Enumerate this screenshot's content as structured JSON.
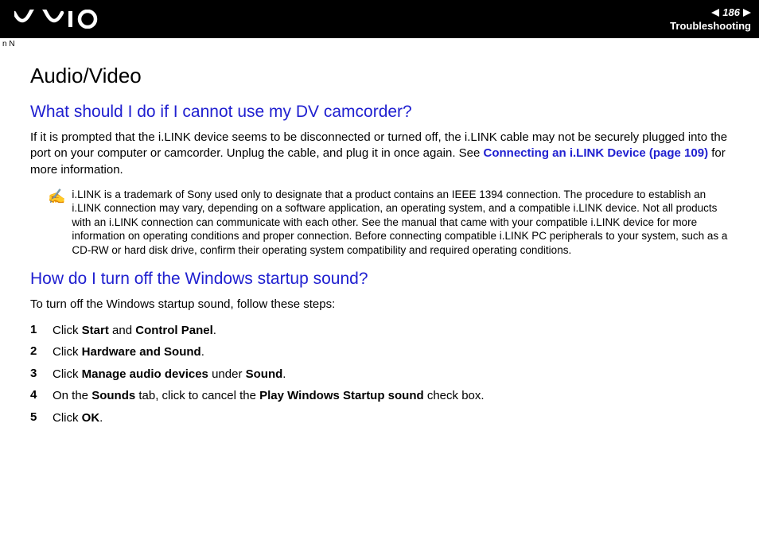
{
  "header": {
    "page_number": "186",
    "section": "Troubleshooting"
  },
  "content": {
    "title": "Audio/Video",
    "q1_heading": "What should I do if I cannot use my DV camcorder?",
    "q1_body_pre": "If it is prompted that the i.LINK device seems to be disconnected or turned off, the i.LINK cable may not be securely plugged into the port on your computer or camcorder. Unplug the cable, and plug it in once again. See ",
    "q1_body_link": "Connecting an i.LINK Device (page 109)",
    "q1_body_post": " for more information.",
    "note": "i.LINK is a trademark of Sony used only to designate that a product contains an IEEE 1394 connection. The procedure to establish an i.LINK connection may vary, depending on a software application, an operating system, and a compatible i.LINK device. Not all products with an i.LINK connection can communicate with each other. See the manual that came with your compatible i.LINK device for more information on operating conditions and proper connection. Before connecting compatible i.LINK PC peripherals to your system, such as a CD-RW or hard disk drive, confirm their operating system compatibility and required operating conditions.",
    "q2_heading": "How do I turn off the Windows startup sound?",
    "q2_intro": "To turn off the Windows startup sound, follow these steps:",
    "steps": {
      "s1_num": "1",
      "s1_pre": "Click ",
      "s1_b1": "Start",
      "s1_mid": " and ",
      "s1_b2": "Control Panel",
      "s1_post": ".",
      "s2_num": "2",
      "s2_pre": "Click ",
      "s2_b1": "Hardware and Sound",
      "s2_post": ".",
      "s3_num": "3",
      "s3_pre": "Click ",
      "s3_b1": "Manage audio devices",
      "s3_mid": " under ",
      "s3_b2": "Sound",
      "s3_post": ".",
      "s4_num": "4",
      "s4_pre": "On the ",
      "s4_b1": "Sounds",
      "s4_mid": " tab, click to cancel the ",
      "s4_b2": "Play Windows Startup sound",
      "s4_post": " check box.",
      "s5_num": "5",
      "s5_pre": "Click ",
      "s5_b1": "OK",
      "s5_post": "."
    }
  },
  "margin_marker": "n N"
}
